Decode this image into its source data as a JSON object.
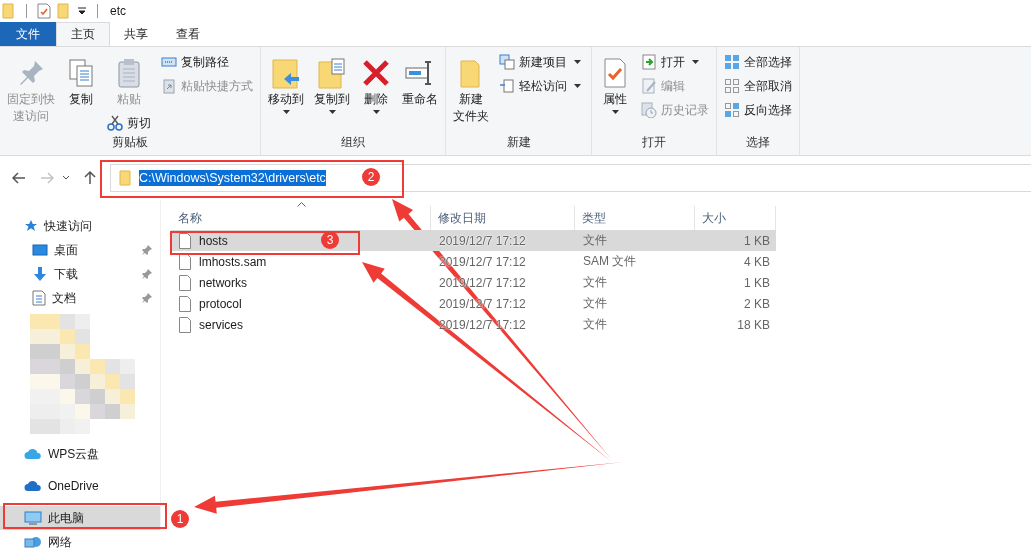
{
  "title_bar": {
    "title": "etc"
  },
  "ribbon_tabs": [
    {
      "label": "文件",
      "kind": "file",
      "selected": false
    },
    {
      "label": "主页",
      "kind": "tab",
      "selected": true
    },
    {
      "label": "共享",
      "kind": "tab",
      "selected": false
    },
    {
      "label": "查看",
      "kind": "tab",
      "selected": false
    }
  ],
  "ribbon_groups": [
    {
      "label": "剪贴板",
      "columns": [
        [
          {
            "kind": "large",
            "lines": [
              "固定到快",
              "速访问"
            ],
            "disabled": true,
            "has_menu": false
          }
        ],
        [
          {
            "kind": "large",
            "lines": [
              "复制"
            ],
            "disabled": false,
            "has_menu": false
          }
        ],
        [
          {
            "kind": "large",
            "lines": [
              "粘贴"
            ],
            "disabled": true,
            "has_menu": false
          },
          {
            "kind": "small",
            "lines": [
              "剪切"
            ],
            "disabled": false,
            "has_menu": false
          }
        ],
        [
          {
            "kind": "small",
            "lines": [
              "复制路径"
            ],
            "disabled": false,
            "has_menu": false
          },
          {
            "kind": "small",
            "lines": [
              "粘贴快捷方式"
            ],
            "disabled": true,
            "has_menu": false
          }
        ]
      ]
    },
    {
      "label": "组织",
      "columns": [
        [
          {
            "kind": "large",
            "lines": [
              "移动到"
            ],
            "disabled": false,
            "has_menu": true
          }
        ],
        [
          {
            "kind": "large",
            "lines": [
              "复制到"
            ],
            "disabled": false,
            "has_menu": true
          }
        ],
        [
          {
            "kind": "large",
            "lines": [
              "删除"
            ],
            "disabled": false,
            "has_menu": true
          }
        ],
        [
          {
            "kind": "large",
            "lines": [
              "重命名"
            ],
            "disabled": false,
            "has_menu": false
          }
        ]
      ]
    },
    {
      "label": "新建",
      "columns": [
        [
          {
            "kind": "large",
            "lines": [
              "新建",
              "文件夹"
            ],
            "disabled": false,
            "has_menu": false
          }
        ],
        [
          {
            "kind": "small",
            "lines": [
              "新建项目"
            ],
            "disabled": false,
            "has_menu": true
          },
          {
            "kind": "small",
            "lines": [
              "轻松访问"
            ],
            "disabled": false,
            "has_menu": true
          }
        ]
      ]
    },
    {
      "label": "打开",
      "columns": [
        [
          {
            "kind": "large",
            "lines": [
              "属性"
            ],
            "disabled": false,
            "has_menu": true
          }
        ],
        [
          {
            "kind": "small",
            "lines": [
              "打开"
            ],
            "disabled": false,
            "has_menu": true
          },
          {
            "kind": "small",
            "lines": [
              "编辑"
            ],
            "disabled": true,
            "has_menu": false
          },
          {
            "kind": "small",
            "lines": [
              "历史记录"
            ],
            "disabled": true,
            "has_menu": false
          }
        ]
      ]
    },
    {
      "label": "选择",
      "columns": [
        [
          {
            "kind": "small",
            "lines": [
              "全部选择"
            ],
            "disabled": false,
            "has_menu": false
          },
          {
            "kind": "small",
            "lines": [
              "全部取消"
            ],
            "disabled": false,
            "has_menu": false
          },
          {
            "kind": "small",
            "lines": [
              "反向选择"
            ],
            "disabled": false,
            "has_menu": false
          }
        ]
      ]
    }
  ],
  "navigation": {
    "back_disabled": false,
    "forward_disabled": true
  },
  "address_bar": {
    "value": "C:\\Windows\\System32\\drivers\\etc",
    "text_selected": true
  },
  "sidebar": {
    "items": [
      {
        "label": "快速访问",
        "selected": false,
        "children": [
          {
            "label": "桌面",
            "pinned": true,
            "selected": false
          },
          {
            "label": "下载",
            "pinned": true,
            "selected": false
          },
          {
            "label": "文档",
            "pinned": true,
            "selected": false
          }
        ]
      },
      {
        "label": "WPS云盘",
        "selected": false
      },
      {
        "label": "OneDrive",
        "selected": false
      },
      {
        "label": "此电脑",
        "selected": true
      },
      {
        "label": "网络",
        "selected": false
      }
    ]
  },
  "file_list": {
    "columns": [
      "名称",
      "修改日期",
      "类型",
      "大小"
    ],
    "rows": [
      {
        "name": "hosts",
        "modified": "2019/12/7 17:12",
        "type": "文件",
        "size": "1 KB",
        "selected": true
      },
      {
        "name": "lmhosts.sam",
        "modified": "2019/12/7 17:12",
        "type": "SAM 文件",
        "size": "4 KB",
        "selected": false
      },
      {
        "name": "networks",
        "modified": "2019/12/7 17:12",
        "type": "文件",
        "size": "1 KB",
        "selected": false
      },
      {
        "name": "protocol",
        "modified": "2019/12/7 17:12",
        "type": "文件",
        "size": "2 KB",
        "selected": false
      },
      {
        "name": "services",
        "modified": "2019/12/7 17:12",
        "type": "文件",
        "size": "18 KB",
        "selected": false
      }
    ]
  },
  "annotations": [
    {
      "number": "1"
    },
    {
      "number": "2"
    },
    {
      "number": "3"
    }
  ]
}
